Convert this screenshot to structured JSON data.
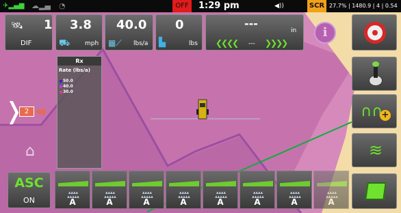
{
  "status_bar": {
    "off_label": "OFF",
    "time": "1:29 pm",
    "scr_label": "SCR",
    "stats": "27.7% | 1480.9 | 4 | 0.54",
    "colors": {
      "off": "#e21b1b",
      "scr": "#f2a11a",
      "signal": "#3cd23c"
    }
  },
  "gps_tile": {
    "value": "1",
    "label": "DIF",
    "icon": "satellite-icon"
  },
  "speed_tile": {
    "value": "3.8",
    "unit": "mph",
    "icon": "tractor-icon"
  },
  "rate_tile": {
    "value": "40.0",
    "unit": "lbs/a",
    "icon": "spreader-rate-icon"
  },
  "total_tile": {
    "value": "0",
    "unit": "lbs",
    "icon": "tank-icon"
  },
  "guidance_tile": {
    "value": "---",
    "unit": "in",
    "offset": "---"
  },
  "rx_panel": {
    "title": "Rx",
    "rate_label": "Rate (lbs/a)",
    "legend": [
      {
        "value": "50.0",
        "color": "#3b1fd0"
      },
      {
        "value": "40.0",
        "color": "#b43fd6"
      },
      {
        "value": "30.0",
        "color": "#e23a8a"
      }
    ]
  },
  "camera_badge": {
    "value": "2"
  },
  "asc": {
    "label": "ASC",
    "state": "ON",
    "color": "#6ee22e"
  },
  "sections": [
    {
      "letter": "A",
      "enabled": true
    },
    {
      "letter": "A",
      "enabled": true
    },
    {
      "letter": "A",
      "enabled": true
    },
    {
      "letter": "A",
      "enabled": true
    },
    {
      "letter": "A",
      "enabled": true
    },
    {
      "letter": "A",
      "enabled": true
    },
    {
      "letter": "A",
      "enabled": true
    },
    {
      "letter": "A",
      "enabled": false
    }
  ],
  "right_buttons": [
    "steering-wheel-icon",
    "joystick-icon",
    "add-waypoint-icon",
    "boundary-icon",
    "field-map-icon"
  ],
  "colors": {
    "field": "#c673ad",
    "applied": "#d388b8",
    "unapplied": "#f3dca7",
    "boundary": "#9a4fa2"
  }
}
